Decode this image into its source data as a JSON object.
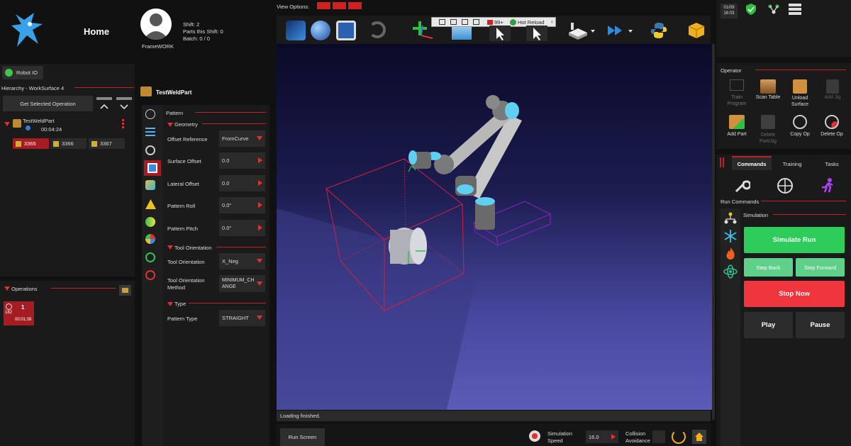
{
  "header": {
    "title": "Home",
    "user": "FrameWORK",
    "shift": "Shift: 2",
    "parts_this_shift": "Parts this Shift: 0",
    "batch": "Batch: 0 / 0"
  },
  "view_options": {
    "label": "View Options:"
  },
  "clock": {
    "date": "01/09",
    "time": "16:03"
  },
  "robot_io": {
    "label": "Robot IO"
  },
  "hierarchy": {
    "title": "Hierarchy - WorkSurface 4",
    "get_selected_label": "Get Selected Operation",
    "part_name": "TestWeldPart",
    "part_time": "00:04:24",
    "jobs": [
      "3365",
      "3366",
      "3367"
    ]
  },
  "operations": {
    "title": "Operations",
    "op_number": "1",
    "op_code": "182",
    "op_time": "00:01:39"
  },
  "weld_part": {
    "title": "TestWeldPart"
  },
  "pattern": {
    "title": "Pattern",
    "geometry_title": "Geometry",
    "offset_reference_label": "Offset Reference",
    "offset_reference_value": "FromCurve",
    "surface_offset_label": "Surface Offset",
    "surface_offset_value": "0.0",
    "lateral_offset_label": "Lateral Offset",
    "lateral_offset_value": "0.0",
    "pattern_roll_label": "Pattern Roll",
    "pattern_roll_value": "0.0°",
    "pattern_pitch_label": "Pattern Pitch",
    "pattern_pitch_value": "0.0°",
    "tool_orientation_title": "Tool Orientation",
    "tool_orientation_label": "Tool Orientation",
    "tool_orientation_value": "X_Neg",
    "tool_orientation_method_label": "Tool Orientation Method",
    "tool_orientation_method_value": "MINIMUM_CHANGE",
    "type_title": "Type",
    "pattern_type_label": "Pattern Type",
    "pattern_type_value": "STRAIGHT"
  },
  "toolbar": {
    "notif_count": "99+",
    "hot_reload_label": "Hot Reload"
  },
  "viewport": {
    "status": "Loading finished."
  },
  "bottom_bar": {
    "run_screen_label": "Run Screen",
    "sim_speed_label": "Simulation Speed",
    "sim_speed_value": "16.0",
    "collision_label": "Collision Avoidance"
  },
  "operator": {
    "title": "Operator",
    "items": [
      {
        "label": "Train Program",
        "icon": "train-program-icon"
      },
      {
        "label": "Scan Table",
        "icon": "scan-table-icon"
      },
      {
        "label": "Unload Surface",
        "icon": "unload-surface-icon"
      },
      {
        "label": "Add Jig",
        "icon": "add-jig-icon"
      },
      {
        "label": "Add Part",
        "icon": "add-part-icon"
      },
      {
        "label": "Delete Part/Jig",
        "icon": "delete-part-jig-icon"
      },
      {
        "label": "Copy Op",
        "icon": "copy-op-icon"
      },
      {
        "label": "Delete Op",
        "icon": "delete-op-icon"
      }
    ]
  },
  "commands": {
    "tabs": [
      "Commands",
      "Training",
      "Tasks"
    ],
    "run_commands_label": "Run Commands",
    "simulation_title": "Simulation",
    "simulate_run": "Simulate Run",
    "step_back": "Step Back",
    "step_forward": "Step Forward",
    "stop_now": "Stop Now",
    "play": "Play",
    "pause": "Pause"
  },
  "colors": {
    "accent_red": "#c0202a",
    "green": "#2ecc5b",
    "light_green": "#5fd08a",
    "stop_red": "#f0363c",
    "viewport_top": "#0a0a2a",
    "viewport_bottom": "#5a5ab0"
  }
}
